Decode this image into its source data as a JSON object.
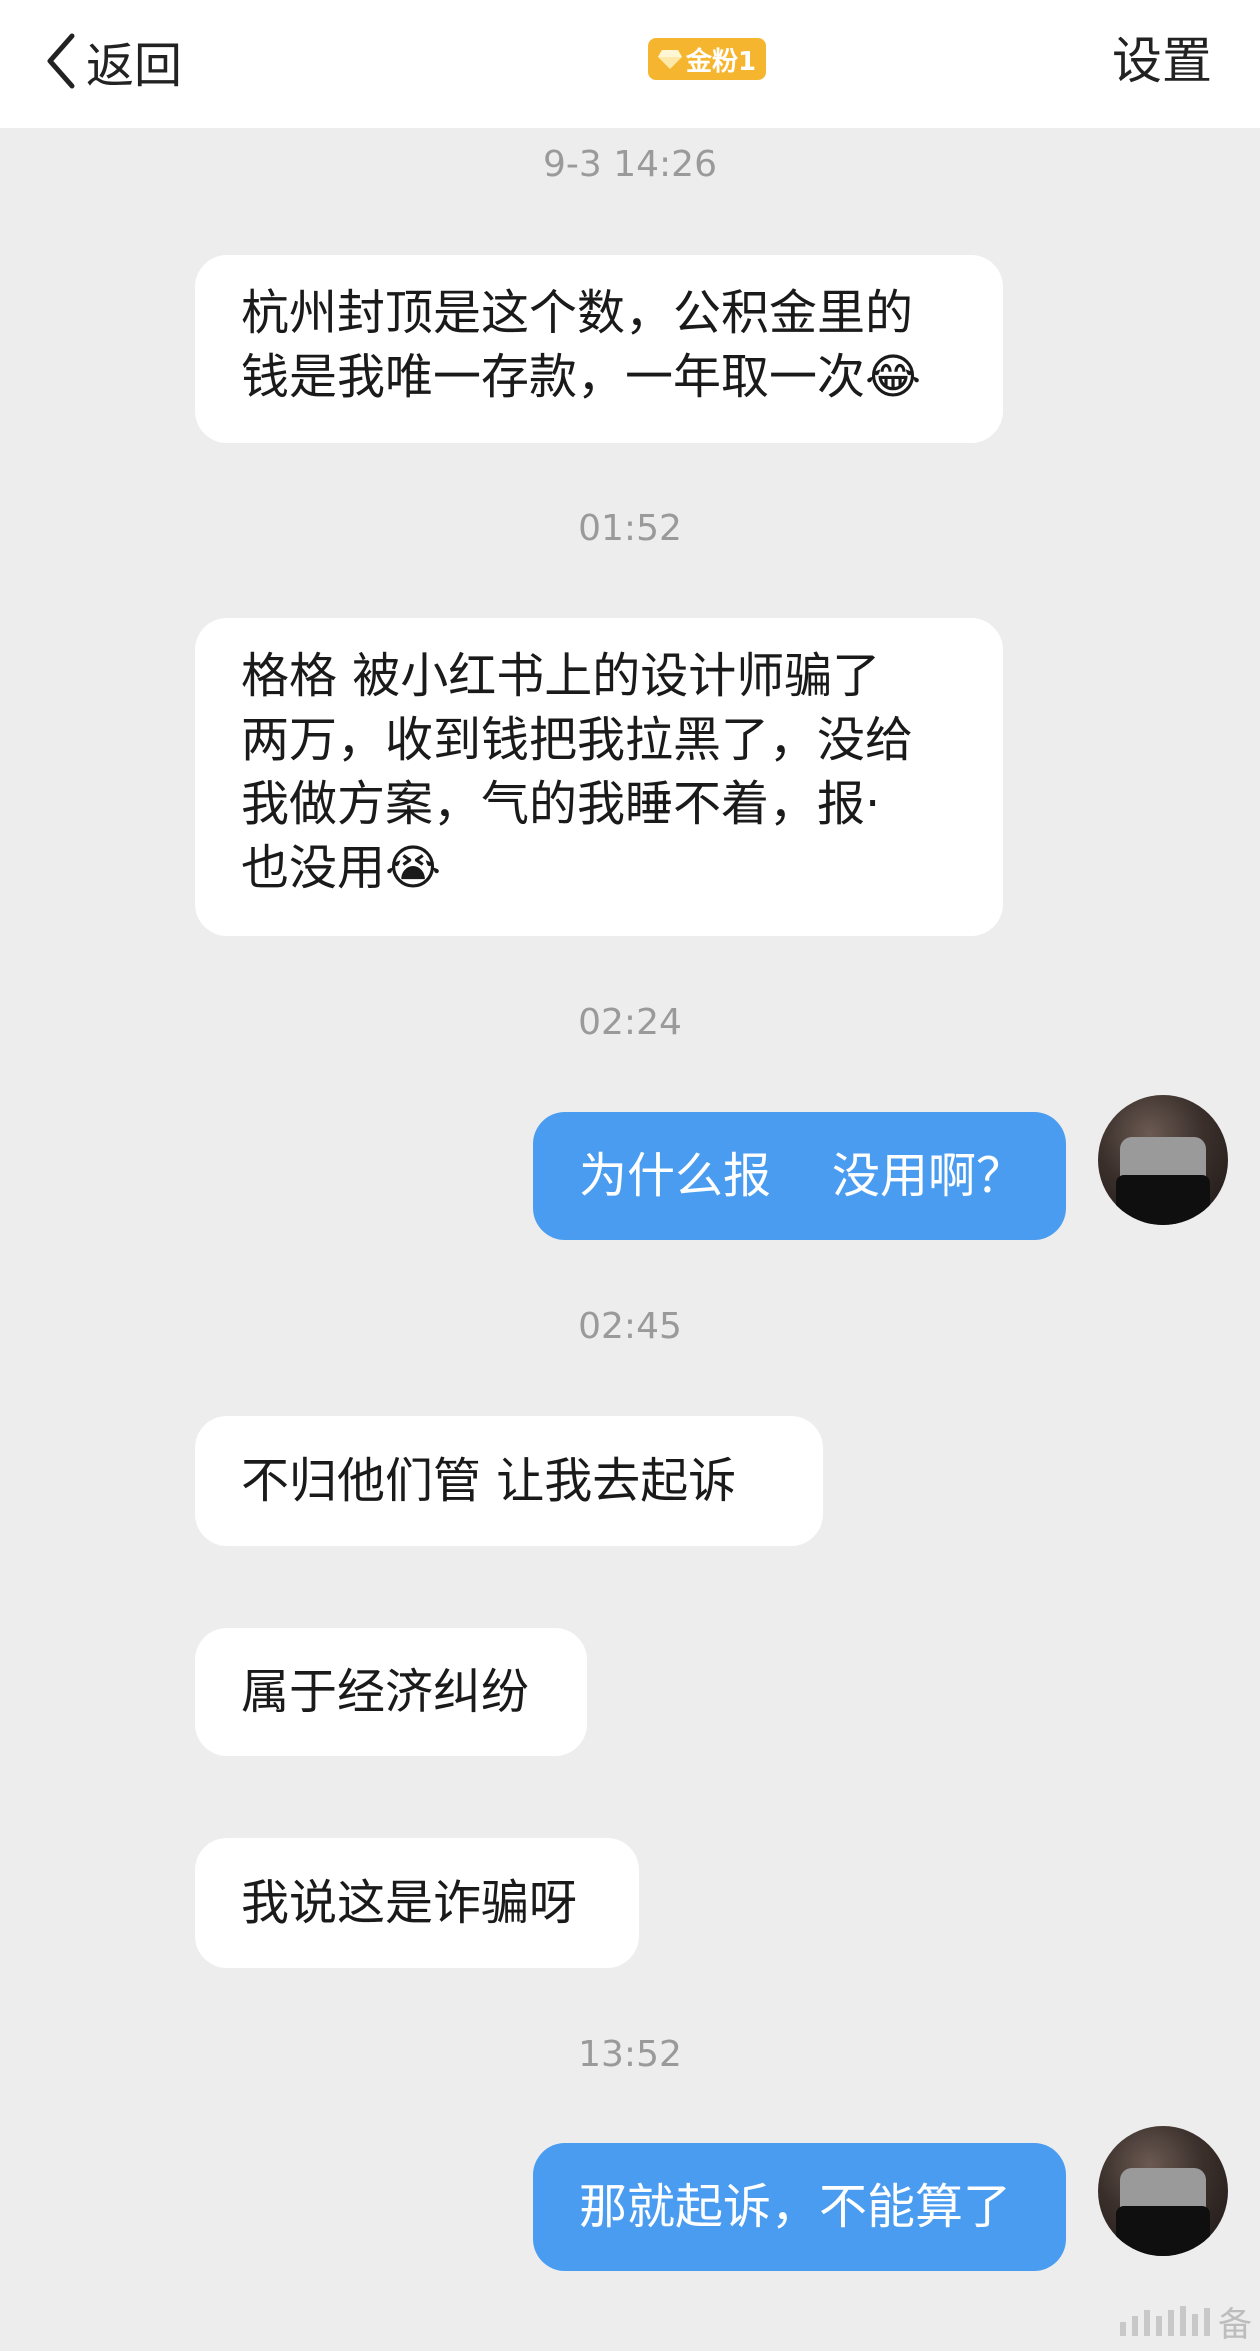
{
  "header": {
    "back_label": "返回",
    "badge_label": "金粉1",
    "settings_label": "设置"
  },
  "messages": [
    {
      "type": "time",
      "text": "9-3 14:26"
    },
    {
      "type": "in",
      "text": "杭州封顶是这个数，公积金里的\n钱是我唯一存款，一年取一次😂"
    },
    {
      "type": "time",
      "text": "01:52"
    },
    {
      "type": "in",
      "text": "格格  被小红书上的设计师骗了\n两万，收到钱把我拉黑了，没给\n我做方案，气的我睡不着，报·\n也没用😭"
    },
    {
      "type": "time",
      "text": "02:24"
    },
    {
      "type": "out",
      "text": "为什么报    没用啊？"
    },
    {
      "type": "time",
      "text": "02:45"
    },
    {
      "type": "in",
      "text": "不归他们管  让我去起诉"
    },
    {
      "type": "in",
      "text": "属于经济纠纷"
    },
    {
      "type": "in",
      "text": "我说这是诈骗呀"
    },
    {
      "type": "time",
      "text": "13:52"
    },
    {
      "type": "out",
      "text": "那就起诉，不能算了"
    }
  ],
  "watermark": {
    "text": "备"
  },
  "colors": {
    "outgoing_bubble": "#4a9cf1",
    "incoming_bubble": "#ffffff",
    "badge": "#f6b52e",
    "background": "#ededed"
  }
}
